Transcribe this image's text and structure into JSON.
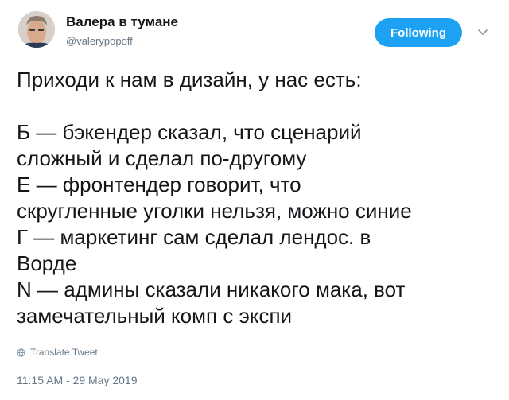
{
  "author": {
    "display_name": "Валера в тумане",
    "handle": "@valerypopoff"
  },
  "follow_button": {
    "label": "Following"
  },
  "menu": {
    "icon": "chevron-down-icon"
  },
  "tweet": {
    "lines": [
      "Приходи к нам в дизайн, у нас есть:",
      "",
      "Б — бэкендер сказал, что сценарий",
      "сложный и сделал по-другому",
      "Е — фронтендер говорит, что",
      "скругленные уголки нельзя, можно синие",
      "Г — маркетинг сам сделал лендос. в",
      "Ворде",
      "N — админы сказали никакого мака, вот",
      "замечательный комп с экспи"
    ],
    "translate_label": "Translate Tweet",
    "timestamp": "11:15 AM - 29 May 2019"
  },
  "colors": {
    "accent": "#1da1f2",
    "text": "#14171a",
    "muted": "#657786"
  }
}
